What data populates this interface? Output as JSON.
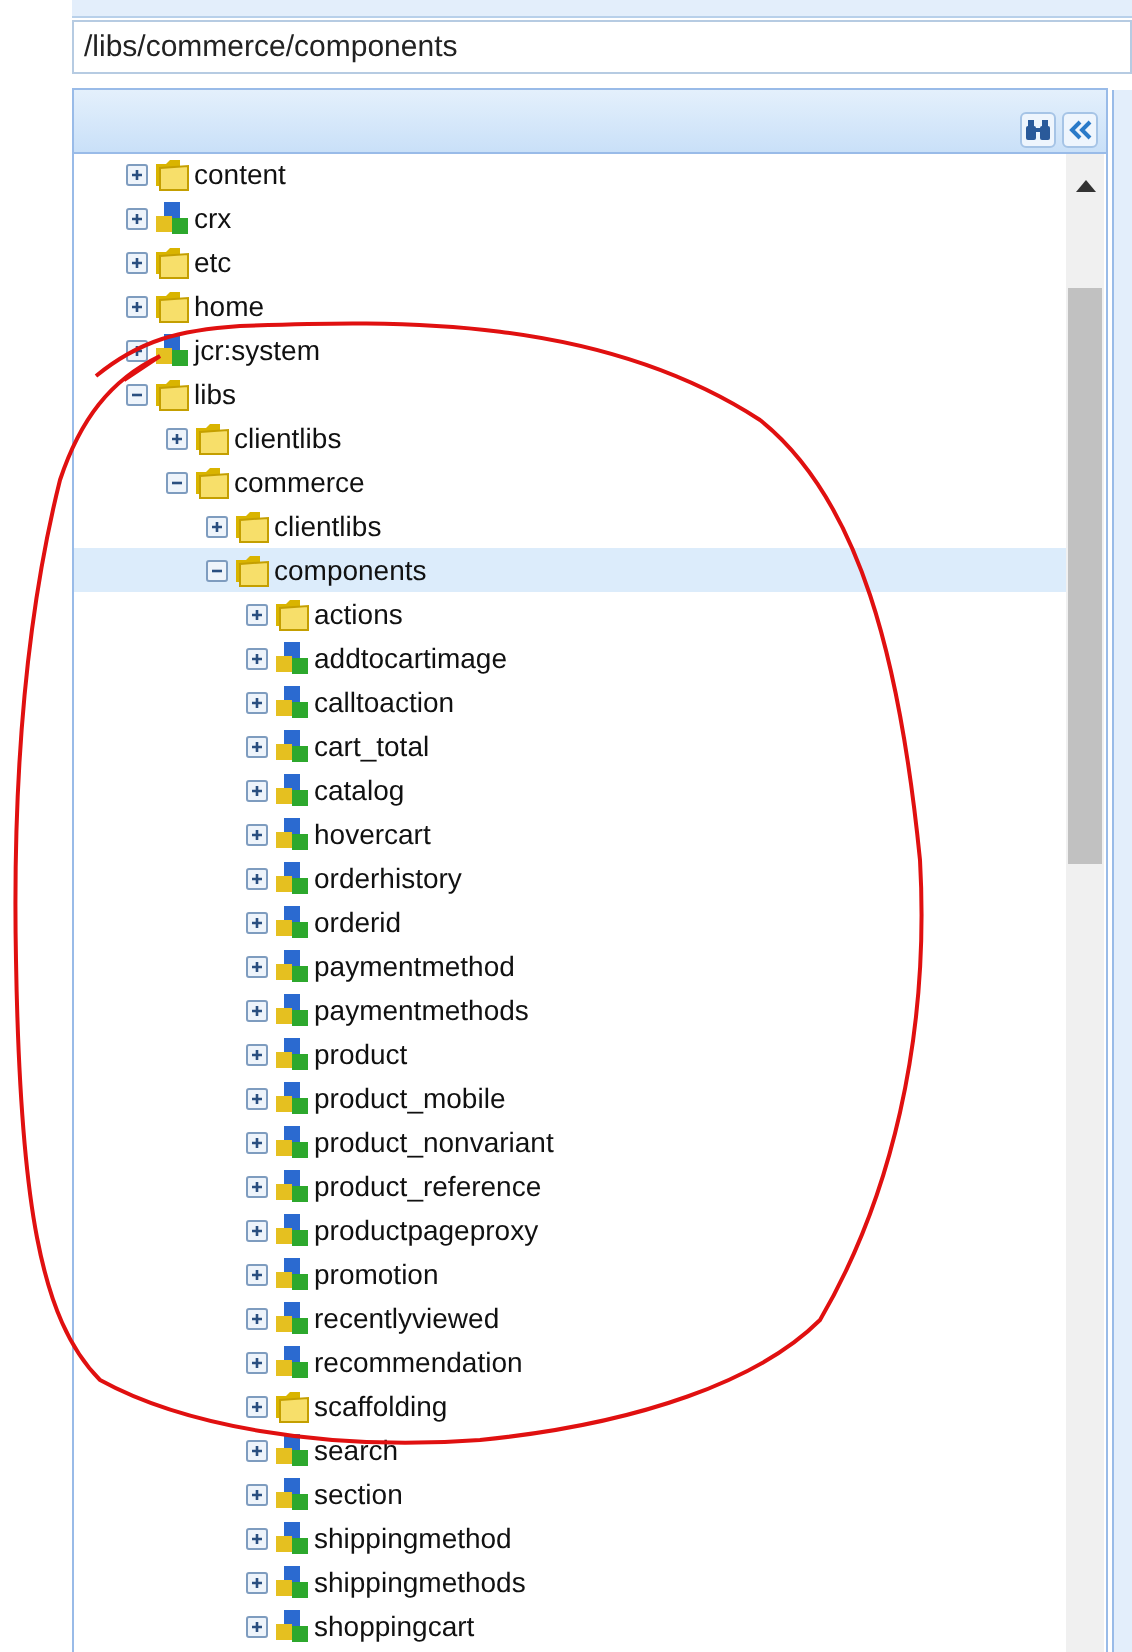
{
  "path_field": {
    "value": "/libs/commerce/components"
  },
  "tree": [
    {
      "label": "content",
      "kind": "folder",
      "expanded": false,
      "selected": false
    },
    {
      "label": "crx",
      "kind": "component",
      "expanded": false,
      "selected": false
    },
    {
      "label": "etc",
      "kind": "folder",
      "expanded": false,
      "selected": false
    },
    {
      "label": "home",
      "kind": "folder",
      "expanded": false,
      "selected": false
    },
    {
      "label": "jcr:system",
      "kind": "component",
      "expanded": false,
      "selected": false
    },
    {
      "label": "libs",
      "kind": "folder",
      "expanded": true,
      "selected": false,
      "children": [
        {
          "label": "clientlibs",
          "kind": "folder",
          "expanded": false,
          "selected": false
        },
        {
          "label": "commerce",
          "kind": "folder",
          "expanded": true,
          "selected": false,
          "children": [
            {
              "label": "clientlibs",
              "kind": "folder",
              "expanded": false,
              "selected": false
            },
            {
              "label": "components",
              "kind": "folder",
              "expanded": true,
              "selected": true,
              "children": [
                {
                  "label": "actions",
                  "kind": "folder",
                  "expanded": false,
                  "selected": false
                },
                {
                  "label": "addtocartimage",
                  "kind": "component",
                  "expanded": false,
                  "selected": false
                },
                {
                  "label": "calltoaction",
                  "kind": "component",
                  "expanded": false,
                  "selected": false
                },
                {
                  "label": "cart_total",
                  "kind": "component",
                  "expanded": false,
                  "selected": false
                },
                {
                  "label": "catalog",
                  "kind": "component",
                  "expanded": false,
                  "selected": false
                },
                {
                  "label": "hovercart",
                  "kind": "component",
                  "expanded": false,
                  "selected": false
                },
                {
                  "label": "orderhistory",
                  "kind": "component",
                  "expanded": false,
                  "selected": false
                },
                {
                  "label": "orderid",
                  "kind": "component",
                  "expanded": false,
                  "selected": false
                },
                {
                  "label": "paymentmethod",
                  "kind": "component",
                  "expanded": false,
                  "selected": false
                },
                {
                  "label": "paymentmethods",
                  "kind": "component",
                  "expanded": false,
                  "selected": false
                },
                {
                  "label": "product",
                  "kind": "component",
                  "expanded": false,
                  "selected": false
                },
                {
                  "label": "product_mobile",
                  "kind": "component",
                  "expanded": false,
                  "selected": false
                },
                {
                  "label": "product_nonvariant",
                  "kind": "component",
                  "expanded": false,
                  "selected": false
                },
                {
                  "label": "product_reference",
                  "kind": "component",
                  "expanded": false,
                  "selected": false
                },
                {
                  "label": "productpageproxy",
                  "kind": "component",
                  "expanded": false,
                  "selected": false
                },
                {
                  "label": "promotion",
                  "kind": "component",
                  "expanded": false,
                  "selected": false
                },
                {
                  "label": "recentlyviewed",
                  "kind": "component",
                  "expanded": false,
                  "selected": false
                },
                {
                  "label": "recommendation",
                  "kind": "component",
                  "expanded": false,
                  "selected": false
                },
                {
                  "label": "scaffolding",
                  "kind": "folder",
                  "expanded": false,
                  "selected": false
                },
                {
                  "label": "search",
                  "kind": "component",
                  "expanded": false,
                  "selected": false
                },
                {
                  "label": "section",
                  "kind": "component",
                  "expanded": false,
                  "selected": false
                },
                {
                  "label": "shippingmethod",
                  "kind": "component",
                  "expanded": false,
                  "selected": false
                },
                {
                  "label": "shippingmethods",
                  "kind": "component",
                  "expanded": false,
                  "selected": false
                },
                {
                  "label": "shoppingcart",
                  "kind": "component",
                  "expanded": false,
                  "selected": false
                }
              ]
            }
          ]
        }
      ]
    }
  ]
}
